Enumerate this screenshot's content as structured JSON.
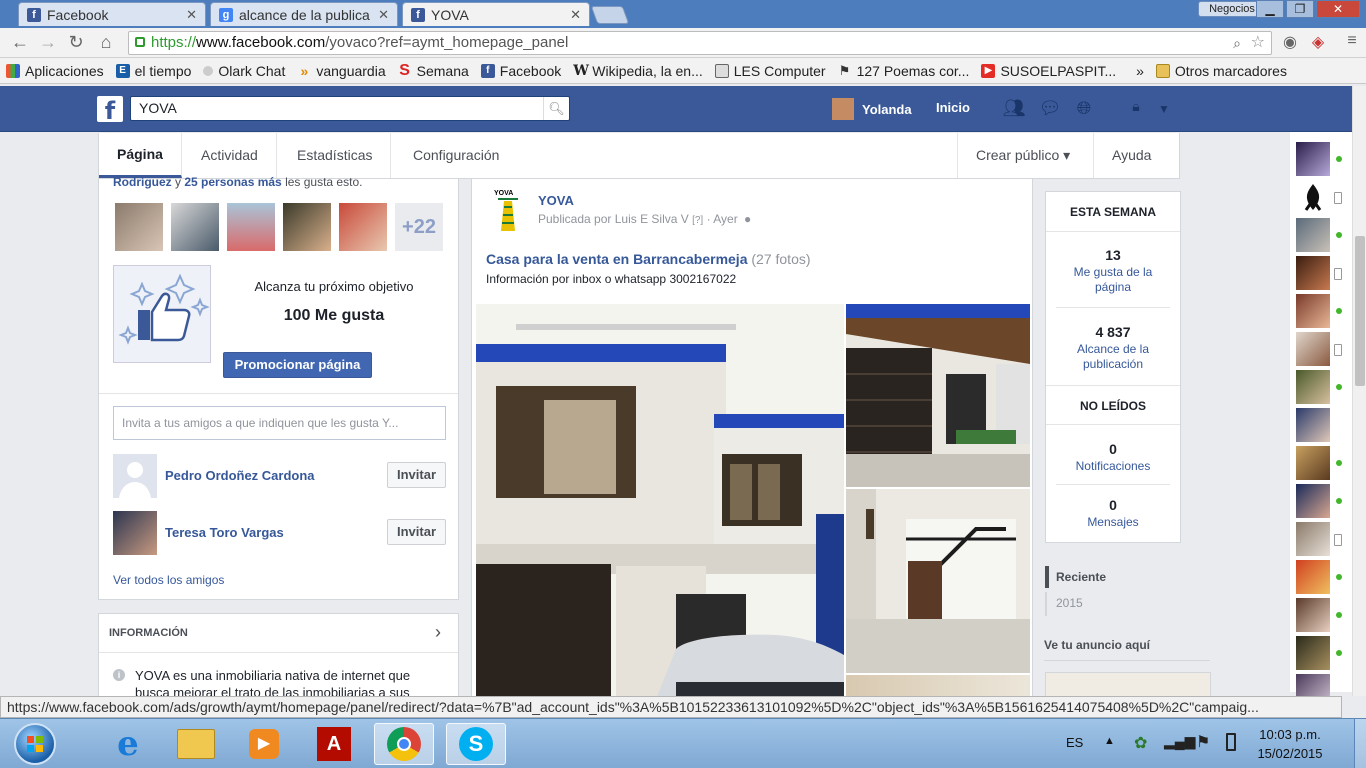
{
  "browser": {
    "tabs": [
      {
        "label": "Facebook",
        "icon": "facebook-icon",
        "active": false
      },
      {
        "label": "alcance de la publica",
        "icon": "google-icon",
        "active": false
      },
      {
        "label": "YOVA",
        "icon": "facebook-icon",
        "active": true
      }
    ],
    "negocios": "Negocios",
    "url_proto": "https://",
    "url_host": "www.facebook.com",
    "url_path": "/yovaco?ref=aymt_homepage_panel",
    "bookmarks": [
      "Aplicaciones",
      "el tiempo",
      "Olark Chat",
      "vanguardia",
      "Semana",
      "Facebook",
      "Wikipedia, la en...",
      "LES Computer",
      "127 Poemas cor...",
      "SUSOELPASPIT...",
      "»",
      "Otros marcadores"
    ],
    "status_url": "https://www.facebook.com/ads/growth/aymt/homepage/panel/redirect/?data=%7B\"ad_account_ids\"%3A%5B10152233613101092%5D%2C\"object_ids\"%3A%5B1561625414075408%5D%2C\"campaig..."
  },
  "fb": {
    "search_value": "YOVA",
    "user_name": "Yolanda",
    "home": "Inicio"
  },
  "page_tabs": {
    "pagina": "Página",
    "actividad": "Actividad",
    "estadisticas": "Estadísticas",
    "configuracion": "Configuración",
    "crear_publico": "Crear público ▾",
    "ayuda": "Ayuda ▾"
  },
  "left": {
    "likes_text_name": "Rodríguez",
    "likes_text_mid": " y ",
    "likes_text_count": "25 personas más",
    "likes_text_end": " les gusta esto.",
    "more_count": "+22",
    "goal_title": "Alcanza tu próximo objetivo",
    "goal_value": "100 Me gusta",
    "promote_button": "Promocionar página",
    "invite_placeholder": "Invita a tus amigos a que indiquen que les gusta Y...",
    "friends": [
      {
        "name": "Pedro Ordoñez Cardona",
        "action": "Invitar"
      },
      {
        "name": "Teresa Toro Vargas",
        "action": "Invitar"
      }
    ],
    "see_all": "Ver todos los amigos",
    "info_header": "INFORMACIÓN",
    "info_text_1": "YOVA es una inmobiliaria nativa de internet que",
    "info_text_2": "busca mejorar el trato de las inmobiliarias a sus"
  },
  "post": {
    "page_name": "YOVA",
    "byline": "Publicada por Luis E Silva V",
    "help": "[?]",
    "time": "· Ayer",
    "album_title": "Casa para la venta en Barrancabermeja",
    "album_count": "(27 fotos)",
    "description": "Información por inbox o whatsapp 3002167022"
  },
  "right": {
    "week_header": "ESTA SEMANA",
    "likes_num": "13",
    "likes_lbl": "Me gusta de la página",
    "reach_num": "4 837",
    "reach_lbl": "Alcance de la publicación",
    "unread_header": "NO LEÍDOS",
    "notif_num": "0",
    "notif_lbl": "Notificaciones",
    "msg_num": "0",
    "msg_lbl": "Mensajes",
    "recent": "Reciente",
    "year": "2015",
    "ad_here": "Ve tu anuncio aquí"
  },
  "taskbar": {
    "lang": "ES",
    "time": "10:03 p.m.",
    "date": "15/02/2015"
  },
  "colors": {
    "fb_blue": "#3b5998",
    "link": "#365899",
    "online": "#42b72a"
  }
}
